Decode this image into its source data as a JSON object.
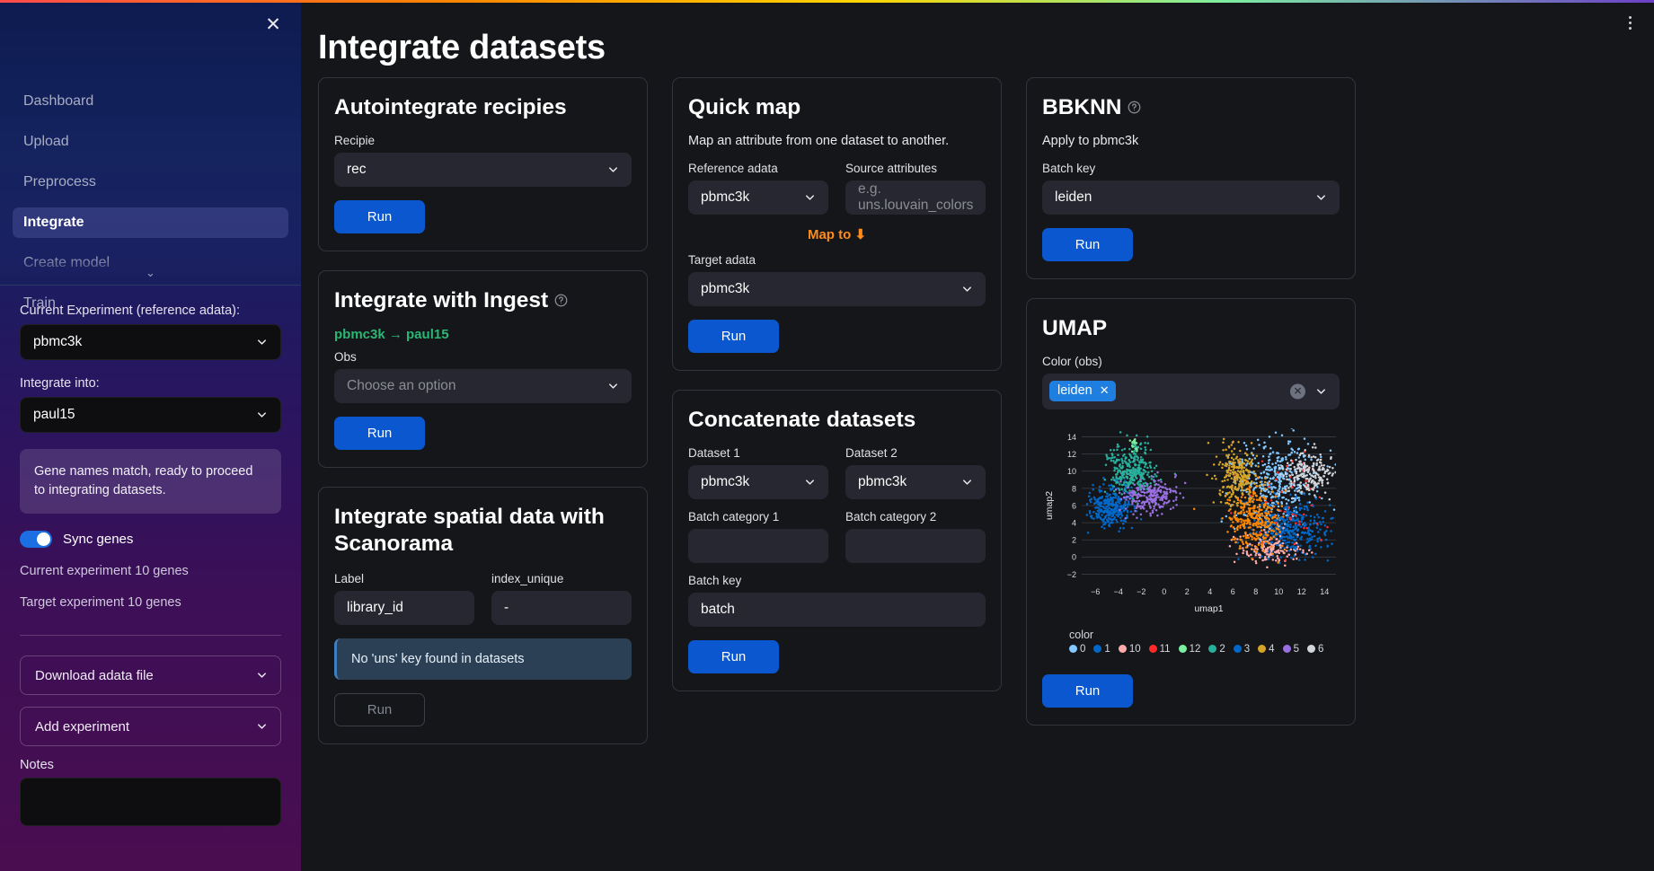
{
  "sidebar": {
    "close_icon": "close-icon",
    "nav_items": [
      {
        "label": "Dashboard",
        "active": false
      },
      {
        "label": "Upload",
        "active": false
      },
      {
        "label": "Preprocess",
        "active": false
      },
      {
        "label": "Integrate",
        "active": true
      },
      {
        "label": "Create model",
        "active": false
      },
      {
        "label": "Train",
        "active": false
      }
    ],
    "current_experiment_label": "Current Experiment (reference adata):",
    "current_experiment_value": "pbmc3k",
    "integrate_into_label": "Integrate into:",
    "integrate_into_value": "paul15",
    "info_message": "Gene names match, ready to proceed to integrating datasets.",
    "sync_genes_label": "Sync genes",
    "current_genes": "Current experiment 10 genes",
    "target_genes": "Target experiment 10 genes",
    "download_expander": "Download adata file",
    "add_experiment_expander": "Add experiment",
    "notes_label": "Notes"
  },
  "header": {
    "title": "Integrate datasets",
    "menu_icon": "kebab-menu-icon"
  },
  "autointegrate": {
    "title": "Autointegrate recipies",
    "recipie_label": "Recipie",
    "recipie_value": "rec",
    "run_label": "Run"
  },
  "ingest": {
    "title": "Integrate with Ingest",
    "help_icon": "help-circle-icon",
    "flow": "pbmc3k → paul15",
    "obs_label": "Obs",
    "obs_value": "Choose an option",
    "run_label": "Run"
  },
  "scanorama": {
    "title": "Integrate spatial data with Scanorama",
    "label_label": "Label",
    "label_value": "library_id",
    "index_unique_label": "index_unique",
    "index_unique_value": "-",
    "warning": "No 'uns' key found in datasets",
    "run_label": "Run"
  },
  "quickmap": {
    "title": "Quick map",
    "subtitle": "Map an attribute from one dataset to another.",
    "reference_label": "Reference adata",
    "reference_value": "pbmc3k",
    "source_attributes_label": "Source attributes",
    "source_attributes_placeholder": "e.g. uns.louvain_colors",
    "source_attributes_value": "",
    "map_to": "Map to",
    "map_to_icon": "down-arrow-icon",
    "target_label": "Target adata",
    "target_value": "pbmc3k",
    "run_label": "Run"
  },
  "concatenate": {
    "title": "Concatenate datasets",
    "dataset1_label": "Dataset 1",
    "dataset1_value": "pbmc3k",
    "dataset2_label": "Dataset 2",
    "dataset2_value": "pbmc3k",
    "batch_category1_label": "Batch category 1",
    "batch_category1_value": "",
    "batch_category2_label": "Batch category 2",
    "batch_category2_value": "",
    "batch_key_label": "Batch key",
    "batch_key_value": "batch",
    "run_label": "Run"
  },
  "bbknn": {
    "title": "BBKNN",
    "help_icon": "help-circle-icon",
    "apply_to": "Apply to pbmc3k",
    "batch_key_label": "Batch key",
    "batch_key_value": "leiden",
    "run_label": "Run"
  },
  "umap": {
    "title": "UMAP",
    "color_obs_label": "Color (obs)",
    "selected_chip": "leiden",
    "clear_icon": "clear-circle-icon",
    "dropdown_icon": "chevron-down-icon",
    "run_label": "Run"
  },
  "chart_data": {
    "type": "scatter",
    "title": "",
    "xlabel": "umap1",
    "ylabel": "umap2",
    "xlim": [
      -7.2,
      15.0
    ],
    "ylim": [
      -3.0,
      15.0
    ],
    "xticks": [
      -6,
      -4,
      -2,
      0,
      2,
      4,
      6,
      8,
      10,
      12,
      14
    ],
    "yticks": [
      -2,
      0,
      2,
      4,
      6,
      8,
      10,
      12,
      14
    ],
    "grid": true,
    "legend_title": "color",
    "legend_position": "bottom",
    "series": [
      {
        "name": "0",
        "color": "#83c9ff",
        "n": 420,
        "cx": 9.6,
        "cy": 8.6,
        "sx": 1.9,
        "sy": 2.4
      },
      {
        "name": "1",
        "color": "#0068c9",
        "n": 400,
        "cx": 10.8,
        "cy": 3.2,
        "sx": 1.8,
        "sy": 1.7
      },
      {
        "name": "10",
        "color": "#ffabab",
        "n": 150,
        "cx": 9.3,
        "cy": 1.0,
        "sx": 1.4,
        "sy": 0.9
      },
      {
        "name": "11",
        "color": "#ff2b2b",
        "n": 55,
        "cx": 10.0,
        "cy": 6.0,
        "sx": 2.2,
        "sy": 2.6
      },
      {
        "name": "12",
        "color": "#7defa1",
        "n": 25,
        "cx": -2.6,
        "cy": 13.1,
        "sx": 0.2,
        "sy": 0.4
      },
      {
        "name": "2",
        "color": "#29b09d",
        "n": 330,
        "cx": -2.9,
        "cy": 10.0,
        "sx": 1.0,
        "sy": 1.5
      },
      {
        "name": "3",
        "color": "#0068c9",
        "n": 300,
        "cx": -4.6,
        "cy": 5.9,
        "sx": 0.9,
        "sy": 1.1
      },
      {
        "name": "4",
        "color": "#d5a429",
        "n": 260,
        "cx": 6.3,
        "cy": 9.3,
        "sx": 0.9,
        "sy": 1.6
      },
      {
        "name": "5",
        "color": "#9a6fe0",
        "n": 230,
        "cx": -1.3,
        "cy": 7.1,
        "sx": 1.2,
        "sy": 1.0
      },
      {
        "name": "6",
        "color": "#d3d6db",
        "n": 200,
        "cx": 12.6,
        "cy": 9.8,
        "sx": 1.1,
        "sy": 1.2
      }
    ],
    "extra_series": [
      {
        "name": "orange",
        "color": "#ff8700",
        "n": 300,
        "cx": 7.9,
        "cy": 4.3,
        "sx": 1.1,
        "sy": 1.7
      }
    ]
  }
}
